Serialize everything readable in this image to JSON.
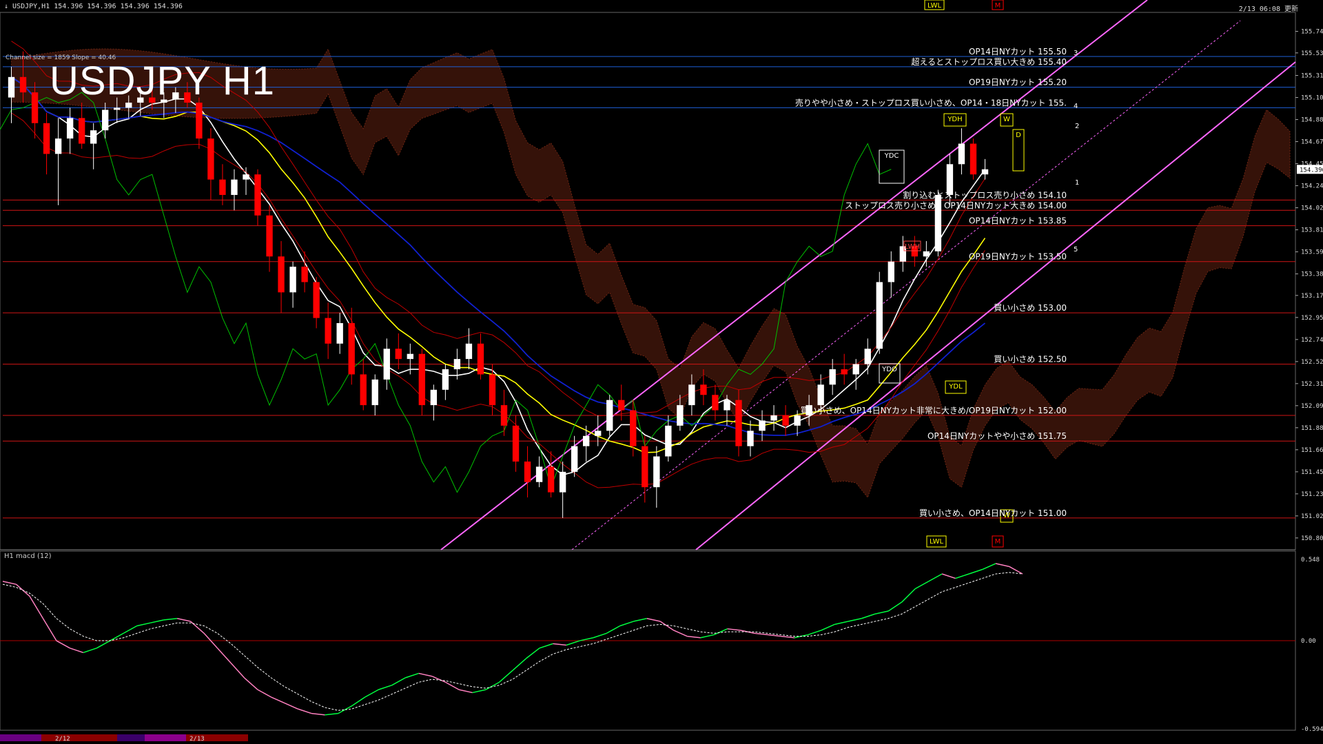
{
  "header": {
    "left": "↓ USDJPY,H1  154.396 154.396 154.396 154.396",
    "right": "2/13 06:08 更新",
    "info": "Channel size = 1859 Slope = 40.46"
  },
  "title": "USDJPY H1",
  "macd_title": "H1  macd (12)",
  "colors": {
    "bull": "#ffffff",
    "bear": "#ff0000",
    "level_line": "#d01515",
    "blue_line": "#1e5fd8",
    "channel": "#ff66ff",
    "sma_white": "#ffffff",
    "sma_yellow": "#ffff00",
    "sma_blue": "#1020d0",
    "chikou": "#00c000",
    "cloud": "#c04020",
    "macd_green": "#00ff40",
    "macd_pink": "#ff80c0"
  },
  "chart_data": [
    {
      "type": "line",
      "title": "USDJPY H1",
      "ylim": [
        150.69,
        155.93
      ],
      "yticks": [
        "155.745",
        "155.535",
        "155.315",
        "155.100",
        "154.885",
        "154.670",
        "154.455",
        "154.240",
        "154.025",
        "153.810",
        "153.595",
        "153.380",
        "153.170",
        "152.955",
        "152.740",
        "152.525",
        "152.310",
        "152.095",
        "151.880",
        "151.665",
        "151.450",
        "151.235",
        "151.020",
        "150.805"
      ],
      "current_price": "154.396",
      "levels": [
        {
          "price": 155.5,
          "label": "OP14日NYカット 155.50",
          "color": "blue"
        },
        {
          "price": 155.4,
          "label": "超えるとストップロス買い大きめ 155.40",
          "color": "blue"
        },
        {
          "price": 155.2,
          "label": "OP19日NYカット 155.20",
          "color": "blue"
        },
        {
          "price": 155.0,
          "label": "売りやや小さめ・ストップロス買い小さめ、OP14・18日NYカット 155.",
          "color": "blue"
        },
        {
          "price": 154.1,
          "label": "割り込むとストップロス売り小さめ 154.10",
          "color": "red"
        },
        {
          "price": 154.0,
          "label": "ストップロス売り小さめ、OP14日NYカット大きめ 154.00",
          "color": "red"
        },
        {
          "price": 153.85,
          "label": "OP14日NYカット 153.85",
          "color": "red"
        },
        {
          "price": 153.5,
          "label": "OP19日NYカット 153.50",
          "color": "red"
        },
        {
          "price": 153.0,
          "label": "買い小さめ 153.00",
          "color": "red"
        },
        {
          "price": 152.5,
          "label": "買い小さめ 152.50",
          "color": "red"
        },
        {
          "price": 152.0,
          "label": "買い小さめ、OP14日NYカット非常に大きめ/OP19日NYカット 152.00",
          "color": "red"
        },
        {
          "price": 151.75,
          "label": "OP14日NYカットやや小さめ 151.75",
          "color": "red"
        },
        {
          "price": 151.0,
          "label": "買い小さめ、OP14日NYカット 151.00",
          "color": "red"
        }
      ],
      "markers": [
        "YDC",
        "YDH",
        "YDO",
        "YDL",
        "LWH",
        "LWL",
        "LWL",
        "W",
        "W",
        "D",
        "M",
        "M"
      ],
      "fan_labels": [
        "1",
        "2",
        "3",
        "4",
        "5"
      ],
      "x_dates": [
        "2/12",
        "2/13"
      ],
      "candles": [
        [
          155.1,
          155.4,
          154.85,
          155.3
        ],
        [
          155.3,
          155.55,
          155.05,
          155.15
        ],
        [
          155.15,
          155.25,
          154.7,
          154.85
        ],
        [
          154.85,
          154.95,
          154.35,
          154.55
        ],
        [
          154.55,
          154.9,
          154.05,
          154.7
        ],
        [
          154.7,
          155.0,
          154.55,
          154.9
        ],
        [
          154.9,
          155.05,
          154.6,
          154.65
        ],
        [
          154.65,
          154.85,
          154.4,
          154.78
        ],
        [
          154.78,
          155.05,
          154.7,
          154.98
        ],
        [
          154.98,
          155.1,
          154.85,
          155.0
        ],
        [
          155.0,
          155.12,
          154.9,
          155.05
        ],
        [
          155.05,
          155.18,
          154.92,
          155.1
        ],
        [
          155.1,
          155.2,
          154.98,
          155.05
        ],
        [
          155.05,
          155.15,
          154.9,
          155.08
        ],
        [
          155.08,
          155.2,
          154.95,
          155.15
        ],
        [
          155.15,
          155.25,
          155.0,
          155.05
        ],
        [
          155.05,
          155.1,
          154.6,
          154.7
        ],
        [
          154.7,
          154.8,
          154.1,
          154.3
        ],
        [
          154.3,
          154.45,
          154.05,
          154.15
        ],
        [
          154.15,
          154.4,
          154.0,
          154.3
        ],
        [
          154.3,
          154.42,
          154.15,
          154.35
        ],
        [
          154.35,
          154.4,
          153.85,
          153.95
        ],
        [
          153.95,
          154.05,
          153.4,
          153.55
        ],
        [
          153.55,
          153.7,
          153.0,
          153.2
        ],
        [
          153.2,
          153.5,
          153.05,
          153.45
        ],
        [
          153.45,
          153.6,
          153.2,
          153.3
        ],
        [
          153.3,
          153.35,
          152.85,
          152.95
        ],
        [
          152.95,
          153.1,
          152.55,
          152.7
        ],
        [
          152.7,
          153.0,
          152.6,
          152.9
        ],
        [
          152.9,
          153.05,
          152.3,
          152.4
        ],
        [
          152.4,
          152.55,
          152.05,
          152.1
        ],
        [
          152.1,
          152.4,
          152.0,
          152.35
        ],
        [
          152.35,
          152.75,
          152.25,
          152.65
        ],
        [
          152.65,
          152.8,
          152.45,
          152.55
        ],
        [
          152.55,
          152.7,
          152.4,
          152.6
        ],
        [
          152.6,
          152.65,
          152.0,
          152.1
        ],
        [
          152.1,
          152.3,
          151.95,
          152.25
        ],
        [
          152.25,
          152.5,
          152.15,
          152.45
        ],
        [
          152.45,
          152.65,
          152.35,
          152.55
        ],
        [
          152.55,
          152.85,
          152.45,
          152.7
        ],
        [
          152.7,
          152.8,
          152.35,
          152.4
        ],
        [
          152.4,
          152.5,
          152.0,
          152.1
        ],
        [
          152.1,
          152.25,
          151.8,
          151.9
        ],
        [
          151.9,
          152.0,
          151.45,
          151.55
        ],
        [
          151.55,
          151.7,
          151.2,
          151.35
        ],
        [
          151.35,
          151.6,
          151.3,
          151.5
        ],
        [
          151.5,
          151.65,
          151.2,
          151.25
        ],
        [
          151.25,
          151.55,
          151.0,
          151.45
        ],
        [
          151.45,
          151.8,
          151.4,
          151.7
        ],
        [
          151.7,
          151.9,
          151.55,
          151.8
        ],
        [
          151.8,
          152.0,
          151.7,
          151.85
        ],
        [
          151.85,
          152.2,
          151.8,
          152.15
        ],
        [
          152.15,
          152.3,
          151.95,
          152.05
        ],
        [
          152.05,
          152.15,
          151.6,
          151.7
        ],
        [
          151.7,
          151.8,
          151.15,
          151.3
        ],
        [
          151.3,
          151.7,
          151.1,
          151.6
        ],
        [
          151.6,
          152.0,
          151.55,
          151.9
        ],
        [
          151.9,
          152.2,
          151.85,
          152.1
        ],
        [
          152.1,
          152.4,
          152.0,
          152.3
        ],
        [
          152.3,
          152.45,
          152.1,
          152.2
        ],
        [
          152.2,
          152.3,
          151.95,
          152.05
        ],
        [
          152.05,
          152.2,
          151.9,
          152.15
        ],
        [
          152.15,
          152.25,
          151.6,
          151.7
        ],
        [
          151.7,
          151.95,
          151.6,
          151.85
        ],
        [
          151.85,
          152.05,
          151.75,
          151.95
        ],
        [
          151.95,
          152.1,
          151.85,
          152.0
        ],
        [
          152.0,
          152.1,
          151.8,
          151.9
        ],
        [
          151.9,
          152.05,
          151.8,
          152.0
        ],
        [
          152.0,
          152.2,
          151.9,
          152.1
        ],
        [
          152.1,
          152.4,
          152.05,
          152.3
        ],
        [
          152.3,
          152.55,
          152.2,
          152.45
        ],
        [
          152.45,
          152.6,
          152.3,
          152.4
        ],
        [
          152.4,
          152.55,
          152.25,
          152.5
        ],
        [
          152.5,
          152.75,
          152.4,
          152.65
        ],
        [
          152.65,
          153.4,
          152.6,
          153.3
        ],
        [
          153.3,
          153.6,
          153.15,
          153.5
        ],
        [
          153.5,
          153.75,
          153.4,
          153.65
        ],
        [
          153.65,
          153.75,
          153.45,
          153.55
        ],
        [
          153.55,
          153.7,
          153.45,
          153.6
        ],
        [
          153.6,
          154.2,
          153.55,
          154.15
        ],
        [
          154.15,
          154.55,
          154.05,
          154.45
        ],
        [
          154.45,
          154.8,
          154.35,
          154.65
        ],
        [
          154.65,
          154.7,
          154.3,
          154.35
        ],
        [
          154.35,
          154.5,
          154.3,
          154.4
        ]
      ]
    },
    {
      "type": "line",
      "title": "H1  macd (12)",
      "ylim": [
        -0.594,
        0.548
      ],
      "yticks": [
        "0.548",
        "0.00",
        "-0.594"
      ],
      "series": [
        {
          "values": [
            0.4,
            0.38,
            0.3,
            0.15,
            0.0,
            -0.05,
            -0.08,
            -0.05,
            0.0,
            0.05,
            0.1,
            0.12,
            0.14,
            0.15,
            0.13,
            0.05,
            -0.05,
            -0.15,
            -0.25,
            -0.33,
            -0.38,
            -0.42,
            -0.46,
            -0.49,
            -0.5,
            -0.49,
            -0.44,
            -0.38,
            -0.33,
            -0.3,
            -0.25,
            -0.22,
            -0.24,
            -0.28,
            -0.33,
            -0.35,
            -0.33,
            -0.28,
            -0.2,
            -0.12,
            -0.05,
            -0.02,
            -0.03,
            0.0,
            0.02,
            0.05,
            0.1,
            0.13,
            0.15,
            0.13,
            0.07,
            0.03,
            0.02,
            0.04,
            0.08,
            0.07,
            0.05,
            0.04,
            0.03,
            0.02,
            0.04,
            0.07,
            0.11,
            0.13,
            0.15,
            0.18,
            0.2,
            0.26,
            0.35,
            0.4,
            0.45,
            0.42,
            0.45,
            0.48,
            0.52,
            0.5,
            0.45
          ]
        },
        {
          "values": [
            0.38,
            0.36,
            0.32,
            0.25,
            0.15,
            0.08,
            0.03,
            0.0,
            0.0,
            0.02,
            0.05,
            0.08,
            0.1,
            0.12,
            0.12,
            0.1,
            0.05,
            -0.02,
            -0.1,
            -0.18,
            -0.25,
            -0.31,
            -0.36,
            -0.41,
            -0.45,
            -0.47,
            -0.46,
            -0.43,
            -0.4,
            -0.36,
            -0.32,
            -0.28,
            -0.26,
            -0.27,
            -0.29,
            -0.31,
            -0.32,
            -0.3,
            -0.26,
            -0.2,
            -0.14,
            -0.09,
            -0.06,
            -0.04,
            -0.02,
            0.01,
            0.04,
            0.07,
            0.1,
            0.11,
            0.1,
            0.08,
            0.06,
            0.05,
            0.06,
            0.06,
            0.06,
            0.05,
            0.04,
            0.03,
            0.03,
            0.04,
            0.06,
            0.09,
            0.11,
            0.13,
            0.15,
            0.18,
            0.23,
            0.28,
            0.33,
            0.36,
            0.39,
            0.42,
            0.45,
            0.46,
            0.45
          ]
        }
      ]
    }
  ]
}
